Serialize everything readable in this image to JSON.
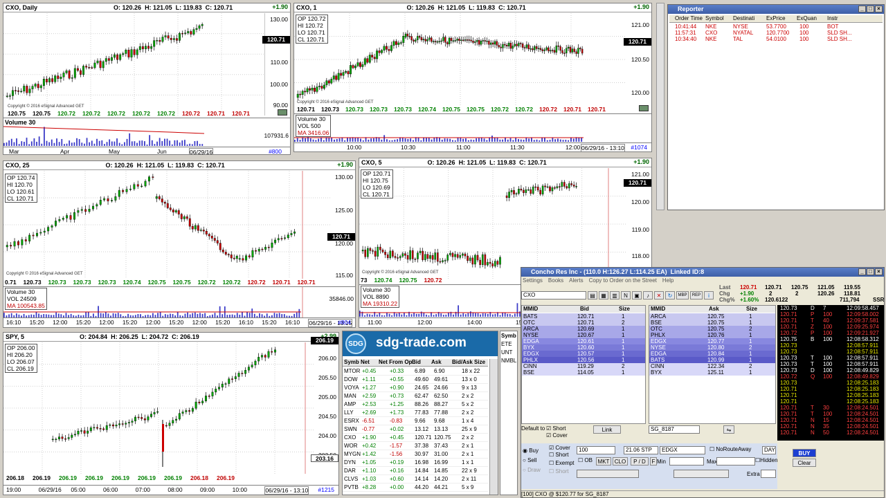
{
  "charts": [
    {
      "title": "CXO, Daily",
      "o": "O: 120.26",
      "h": "H: 121.05",
      "l": "L: 119.83",
      "c": "C: 120.71",
      "chg": "+1.90",
      "y": [
        "130.00",
        "110.00",
        "100.00",
        "90.00"
      ],
      "last": "120.71",
      "prices": [
        "120.75",
        "120.75",
        "120.72",
        "120.72",
        "120.72",
        "120.72",
        "120.72",
        "120.72",
        "120.71",
        "120.71"
      ],
      "vol_title": "Volume 30",
      "vol_label": "107931.6",
      "times": [
        "Mar",
        "Apr",
        "May",
        "Jun",
        "06/29/16"
      ],
      "id": "#800"
    },
    {
      "title": "CXO, 1",
      "o": "O: 120.26",
      "h": "H: 121.05",
      "l": "L: 119.83",
      "c": "C: 120.71",
      "chg": "+1.90",
      "box": [
        "OP 120.72",
        "HI 120.72",
        "LO 120.71",
        "CL 120.71"
      ],
      "y": [
        "121.00",
        "120.50",
        "120.00"
      ],
      "last": "120.71",
      "prices": [
        "120.71",
        "120.73",
        "120.73",
        "120.73",
        "120.73",
        "120.74",
        "120.75",
        "120.75",
        "120.72",
        "120.72",
        "120.72",
        "120.71",
        "120.71"
      ],
      "vol_title": "Volume 30",
      "vol": "VOL 500",
      "ma": "MA 3416.06",
      "times": [
        "10:00",
        "10:30",
        "11:00",
        "11:30",
        "12:00",
        "06/29/16 - 13:10"
      ],
      "id": "#1074"
    },
    {
      "title": "CXO, 25",
      "o": "O: 120.26",
      "h": "H: 121.05",
      "l": "L: 119.83",
      "c": "C: 120.71",
      "chg": "+1.90",
      "box": [
        "OP 120.74",
        "HI 120.70",
        "LO 120.61",
        "CL 120.71"
      ],
      "y": [
        "130.00",
        "125.00",
        "120.00",
        "115.00"
      ],
      "last": "120.71",
      "prices": [
        "0.71",
        "120.73",
        "120.73",
        "120.73",
        "120.73",
        "120.74",
        "120.75",
        "120.75",
        "120.72",
        "120.72",
        "120.72",
        "120.71",
        "120.71"
      ],
      "vol_title": "Volume 30",
      "vol": "VOL 24509",
      "ma": "MA 100543.85",
      "vol_label": "35846.00",
      "times": [
        "16:10",
        "15:20",
        "12:00",
        "15:20",
        "12:00",
        "15:20",
        "12:00",
        "15:20",
        "12:00",
        "15:20",
        "16:10",
        "15:20",
        "16:10",
        "06/29/16 - 13:15"
      ],
      "id": "#804"
    },
    {
      "title": "CXO, 5",
      "o": "O: 120.26",
      "h": "H: 121.05",
      "l": "L: 119.83",
      "c": "C: 120.71",
      "chg": "+1.90",
      "box": [
        "OP 120.71",
        "HI 120.75",
        "LO 120.69",
        "CL 120.71"
      ],
      "y": [
        "121.00",
        "120.00",
        "119.00",
        "118.00"
      ],
      "last": "120.71",
      "prices": [
        "73",
        "120.74",
        "120.75",
        "120.72"
      ],
      "vol_title": "Volume 30",
      "vol": "VOL 8890",
      "ma": "MA 19310.22",
      "times": [
        "11:00",
        "12:00",
        "14:00",
        "15:00"
      ]
    },
    {
      "title": "SPY, 5",
      "o": "O: 204.84",
      "h": "H: 206.25",
      "l": "L: 204.72",
      "c": "C: 206.19",
      "chg": "+2.99",
      "box": [
        "OP 206.00",
        "HI 206.20",
        "LO 206.07",
        "CL 206.19"
      ],
      "y": [
        "206.00",
        "205.50",
        "205.00",
        "204.50",
        "204.00",
        "203.50"
      ],
      "last": "206.19",
      "last2": "203.16",
      "prices": [
        "206.18",
        "206.19",
        "206.19",
        "206.19",
        "206.19",
        "206.19",
        "206.19",
        "206.18",
        "206.19"
      ],
      "times": [
        "19:00",
        "06/29/16",
        "05:00",
        "06:00",
        "07:00",
        "08:00",
        "09:00",
        "10:00",
        "06/29/16 - 13:10"
      ],
      "id": "#1215"
    }
  ],
  "banner": {
    "logo": "SDG",
    "site": "sdg-trade.com"
  },
  "watchlist": {
    "headers": [
      "Symb",
      "Net",
      "Net From Op",
      "Bid",
      "Ask",
      "Bid/Ask Size"
    ],
    "rows": [
      [
        "MTOR",
        "+0.45",
        "+0.33",
        "6.89",
        "6.90",
        "18 x 22"
      ],
      [
        "DOW",
        "+1.11",
        "+0.55",
        "49.60",
        "49.61",
        "13 x 0"
      ],
      [
        "VOYA",
        "+1.27",
        "+0.90",
        "24.65",
        "24.66",
        "9 x 13"
      ],
      [
        "MAN",
        "+2.59",
        "+0.73",
        "62.47",
        "62.50",
        "2 x 2"
      ],
      [
        "AMP",
        "+2.53",
        "+1.25",
        "88.26",
        "88.27",
        "5 x 2"
      ],
      [
        "LLY",
        "+2.69",
        "+1.73",
        "77.83",
        "77.88",
        "2 x 2"
      ],
      [
        "ESRX",
        "-6.51",
        "-0.83",
        "9.66",
        "9.68",
        "1 x 4"
      ],
      [
        "SWN",
        "-0.77",
        "+0.02",
        "13.12",
        "13.13",
        "25 x 9"
      ],
      [
        "CXO",
        "+1.90",
        "+0.45",
        "120.71",
        "120.75",
        "2 x 2"
      ],
      [
        "WOR",
        "+0.42",
        "-1.57",
        "37.38",
        "37.43",
        "2 x 1"
      ],
      [
        "MYGN",
        "+1.42",
        "-1.56",
        "30.97",
        "31.00",
        "2 x 1"
      ],
      [
        "DYN",
        "+1.05",
        "+0.19",
        "16.98",
        "16.99",
        "1 x 1"
      ],
      [
        "DAR",
        "+1.10",
        "+0.16",
        "14.84",
        "14.85",
        "22 x 9"
      ],
      [
        "CLVS",
        "+1.03",
        "+0.60",
        "14.14",
        "14.20",
        "2 x 11"
      ],
      [
        "PVTB",
        "+8.28",
        "+0.00",
        "44.20",
        "44.21",
        "5 x 9"
      ]
    ],
    "side": [
      "Symb",
      "ETE",
      "UNT",
      "NMBL"
    ]
  },
  "reporter": {
    "title": "Reporter",
    "headers": [
      "Order Time",
      "Symbol",
      "Destinati",
      "ExPrice",
      "ExQuan",
      "Instr"
    ],
    "rows": [
      [
        "10:41:44",
        "NKE",
        "NYSE",
        "53.7700",
        "100",
        "BOT"
      ],
      [
        "11:57:31",
        "CXO",
        "NYATAL",
        "120.7700",
        "100",
        "SLD SH..."
      ],
      [
        "10:34:40",
        "NKE",
        "TAL",
        "54.0100",
        "100",
        "SLD SH..."
      ]
    ]
  },
  "level2": {
    "title": "Concho Res Inc - (110.0 H:126.27 L:114.25 EA)",
    "linked": "Linked ID:8",
    "menu": [
      "Settings",
      "Books",
      "Alerts",
      "Copy to Order on the Street",
      "Help"
    ],
    "symbol": "CXO",
    "quote": {
      "last_label": "Last",
      "last": "120.71",
      "chg_label": "Chg",
      "chg": "+1.90",
      "chgpct_label": "Chg%",
      "chgpct": "+1.60%",
      "b": "120.71",
      "a": "120.75",
      "h": "121.05",
      "l": "119.55",
      "bs": "2",
      "as": "2",
      "o": "120.26",
      "c": "118.81",
      "s1": "120.6122",
      "vo": "711,794",
      "ssr": "SSR"
    },
    "bid_headers": [
      "MMID",
      "Bid",
      "Size"
    ],
    "ask_headers": [
      "MMID",
      "Ask",
      "Size"
    ],
    "bids": [
      [
        "BATS",
        "120.71",
        "1"
      ],
      [
        "OTC",
        "120.71",
        "2"
      ],
      [
        "ARCA",
        "120.69",
        "1"
      ],
      [
        "NYSE",
        "120.67",
        "1"
      ],
      [
        "EDGA",
        "120.61",
        "1"
      ],
      [
        "BYX",
        "120.60",
        "1"
      ],
      [
        "EDGX",
        "120.57",
        "1"
      ],
      [
        "PHLX",
        "120.56",
        "1"
      ],
      [
        "CINN",
        "119.29",
        "2"
      ],
      [
        "BSE",
        "114.05",
        "1"
      ]
    ],
    "asks": [
      [
        "ARCA",
        "120.75",
        "1"
      ],
      [
        "BSE",
        "120.75",
        "1"
      ],
      [
        "OTC",
        "120.75",
        "2"
      ],
      [
        "PHLX",
        "120.76",
        "1"
      ],
      [
        "EDGX",
        "120.77",
        "1"
      ],
      [
        "NYSE",
        "120.80",
        "2"
      ],
      [
        "EDGA",
        "120.84",
        "1"
      ],
      [
        "BATS",
        "120.99",
        "1"
      ],
      [
        "CINN",
        "122.34",
        "2"
      ],
      [
        "BYX",
        "125.11",
        "1"
      ]
    ],
    "tape": [
      [
        "120.73",
        "D",
        "7",
        "12:09:58.457"
      ],
      [
        "120.71",
        "P",
        "100",
        "12:09:58.002"
      ],
      [
        "120.71",
        "T",
        "40",
        "12:09:37.581"
      ],
      [
        "120.71",
        "Z",
        "100",
        "12:09:25.974"
      ],
      [
        "120.72",
        "P",
        "100",
        "12:09:21.927"
      ],
      [
        "120.75",
        "B",
        "100",
        "12:08:58.312"
      ],
      [
        "120.73",
        "",
        "",
        "12:08:57.911"
      ],
      [
        "120.73",
        "",
        "",
        "12:08:57.911"
      ],
      [
        "120.73",
        "T",
        "100",
        "12:08:57.911"
      ],
      [
        "120.73",
        "T",
        "100",
        "12:08:57.911"
      ],
      [
        "120.73",
        "D",
        "100",
        "12:08:49.829"
      ],
      [
        "120.72",
        "Q",
        "100",
        "12:08:49.829"
      ],
      [
        "120.73",
        "",
        "",
        "12:08:25.183"
      ],
      [
        "120.71",
        "",
        "",
        "12:08:25.183"
      ],
      [
        "120.71",
        "",
        "",
        "12:08:25.183"
      ],
      [
        "120.71",
        "",
        "",
        "12:08:25.183"
      ],
      [
        "120.71",
        "T",
        "30",
        "12:08:24.501"
      ],
      [
        "120.71",
        "T",
        "100",
        "12:08:24.501"
      ],
      [
        "120.71",
        "N",
        "15",
        "12:08:24.501"
      ],
      [
        "120.71",
        "N",
        "35",
        "12:08:24.501"
      ],
      [
        "120.71",
        "N",
        "50",
        "12:08:24.501"
      ]
    ],
    "default_to": "Default to",
    "short_lbl": "Short",
    "cover_lbl": "Cover",
    "link": "Link",
    "account": "SG_8187",
    "order": {
      "buy": "Buy",
      "sell": "Sell",
      "short": "Short",
      "exempt": "Exempt",
      "cover": "Cover",
      "draw": "Draw",
      "qty": "100",
      "price": "21.06 STP",
      "route": "EDGX",
      "tif": "DAY",
      "noroute": "NoRouteAway",
      "hidden": "Hidden",
      "ob": "OB",
      "mkt": "MKT",
      "clo": "CLO",
      "pdf": "P / D",
      "f": "F",
      "min": "Min",
      "max": "Max",
      "extra": "Extra",
      "buy_btn": "BUY",
      "clear_btn": "Clear"
    },
    "status": "[100] CXO @ $120.77 for SG_8187"
  },
  "colors": {
    "up": "#008000",
    "down": "#c00000",
    "candle_up": "#00aa00",
    "candle_down": "#cc0000"
  }
}
